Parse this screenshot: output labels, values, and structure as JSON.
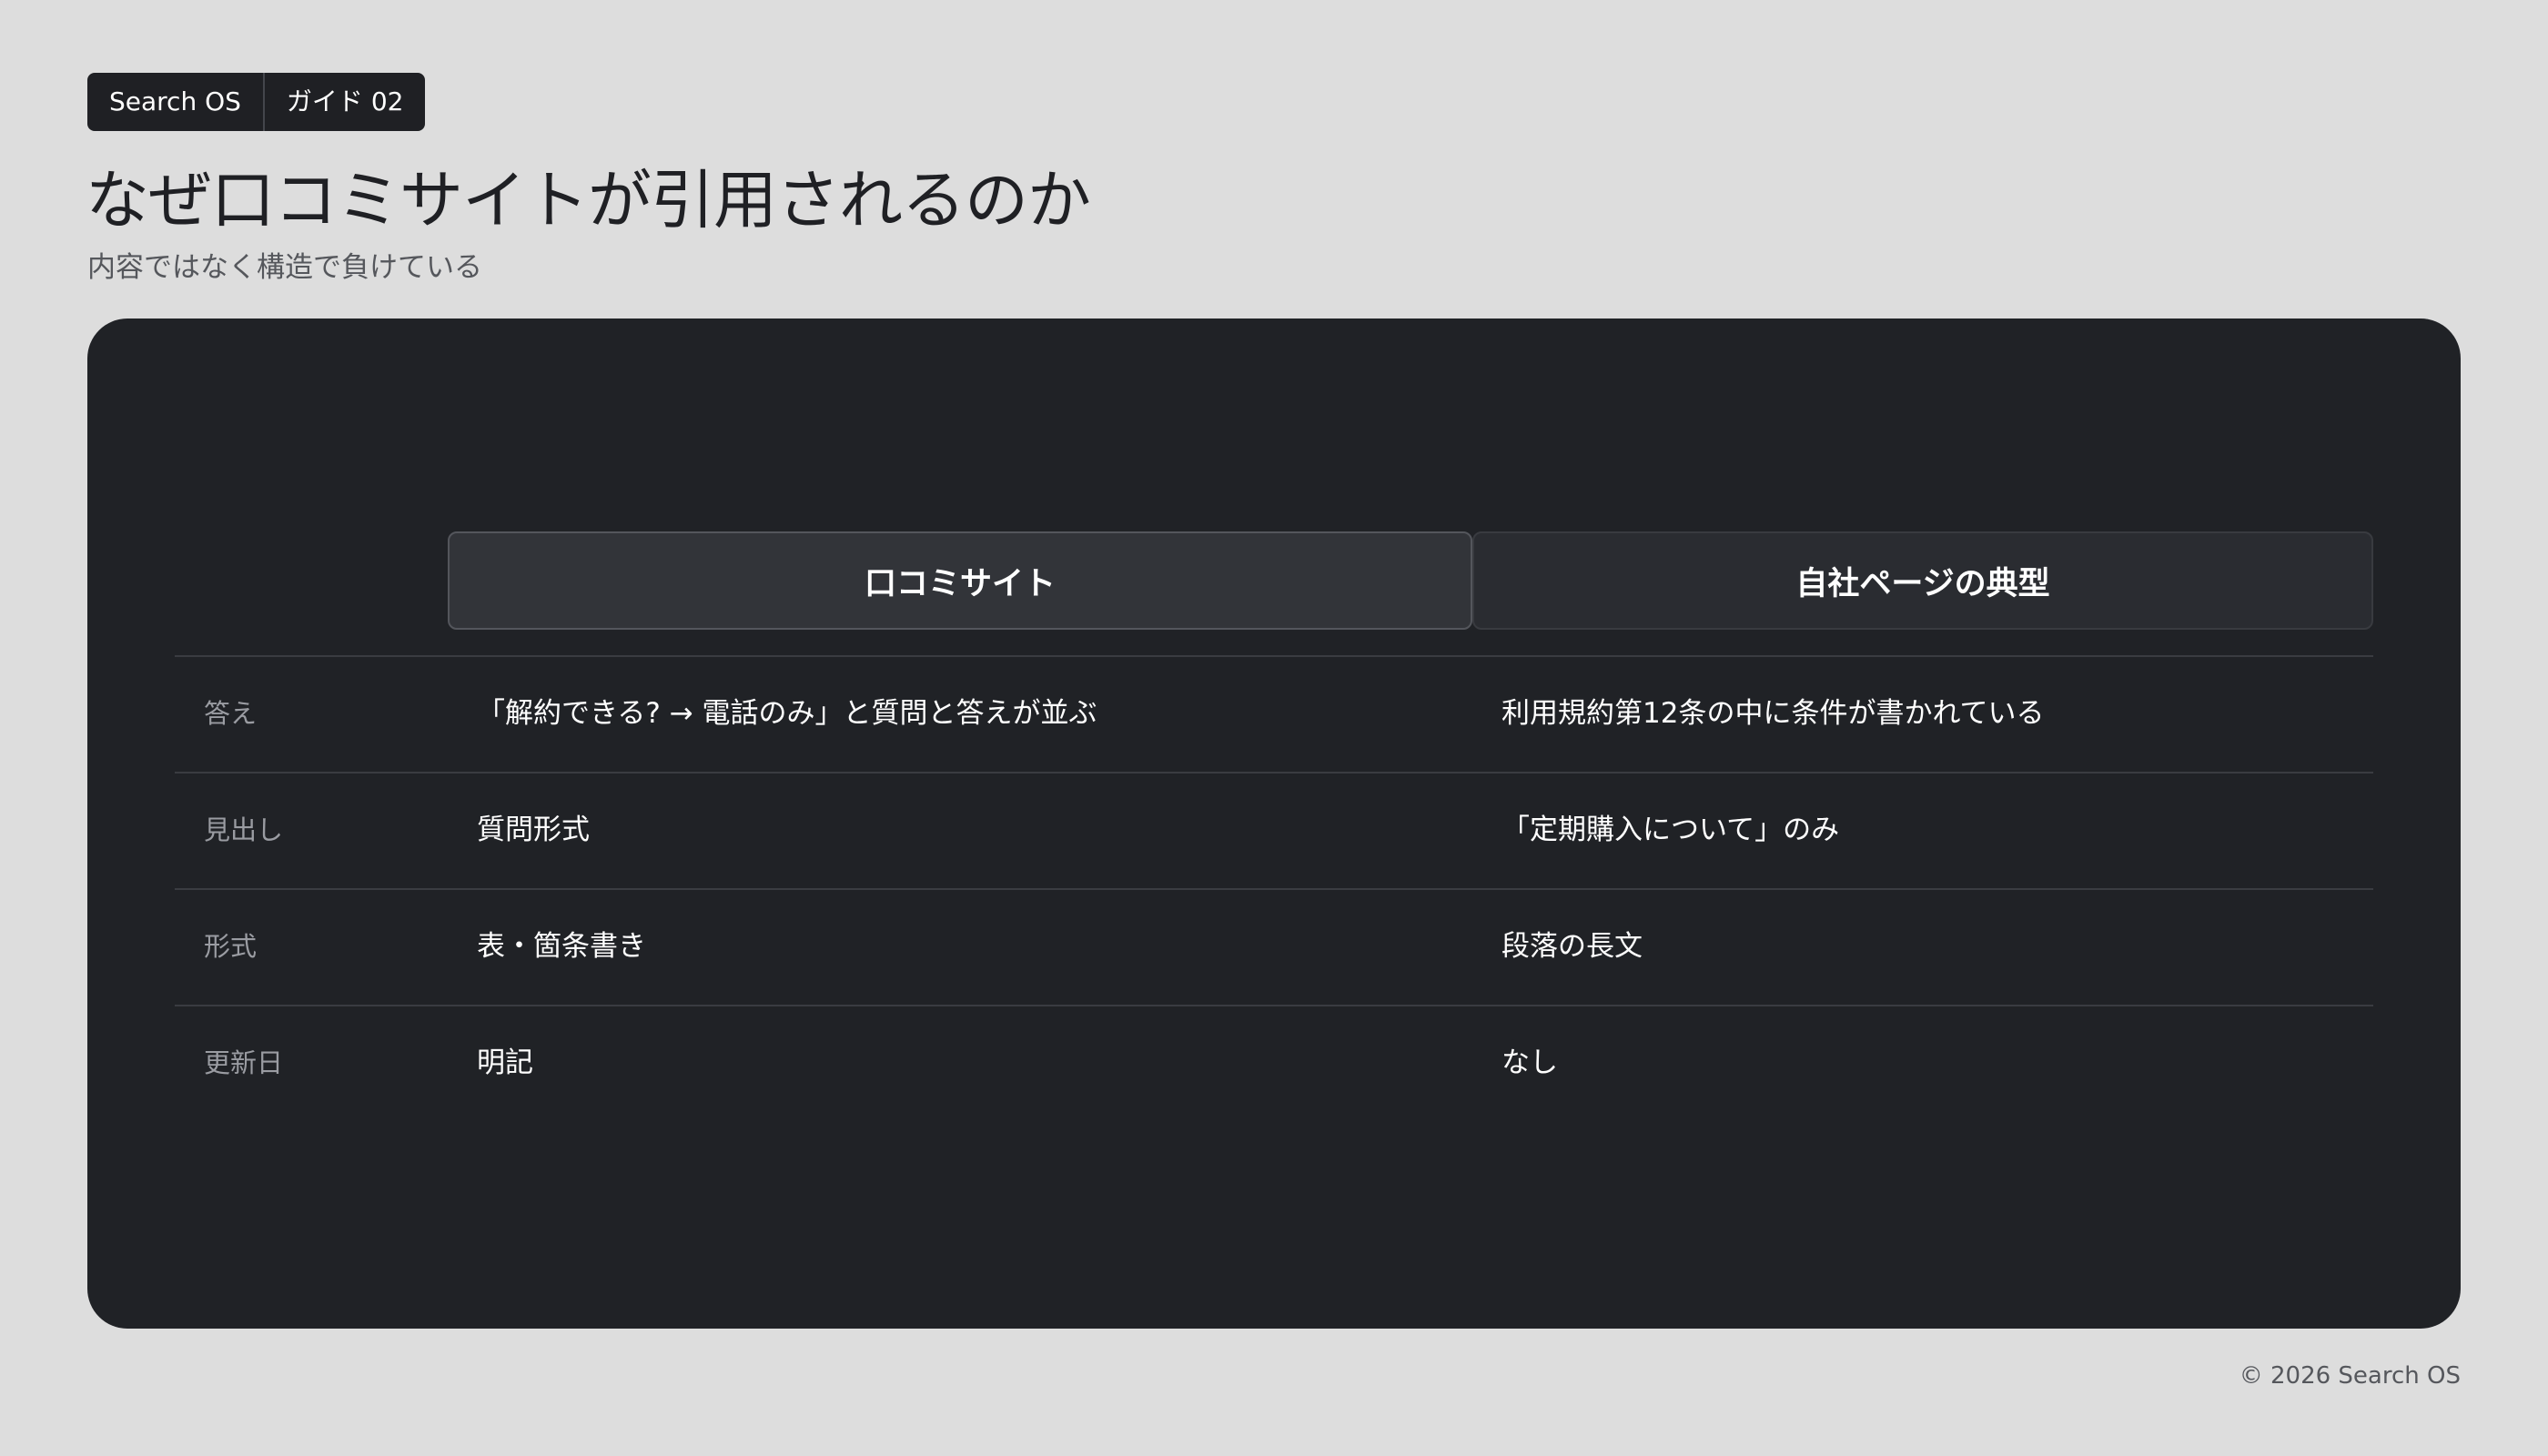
{
  "header": {
    "breadcrumb": [
      "Search OS",
      "ガイド 02"
    ],
    "title": "なぜ口コミサイトが引用されるのか",
    "subtitle": "内容ではなく構造で負けている"
  },
  "comparison": {
    "columns": [
      "口コミサイト",
      "自社ページの典型"
    ],
    "rows": [
      {
        "label": "答え",
        "a": "「解約できる? → 電話のみ」と質問と答えが並ぶ",
        "b": "利用規約第12条の中に条件が書かれている"
      },
      {
        "label": "見出し",
        "a": "質問形式",
        "b": "「定期購入について」のみ"
      },
      {
        "label": "形式",
        "a": "表・箇条書き",
        "b": "段落の長文"
      },
      {
        "label": "更新日",
        "a": "明記",
        "b": "なし"
      }
    ]
  },
  "footer": {
    "copyright": "© 2026 Search OS"
  },
  "colors": {
    "background": "#dddddd",
    "panel": "#202226",
    "highlight_header": "#323439",
    "text_light": "#ffffff",
    "text_muted": "#9a9ca2"
  }
}
